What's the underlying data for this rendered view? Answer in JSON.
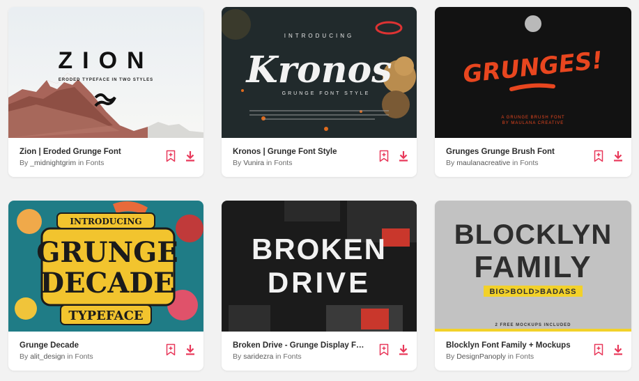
{
  "accent_color": "#e8385a",
  "cards": [
    {
      "title": "Zion | Eroded Grunge Font",
      "by": "By",
      "author": "_midnightgrim",
      "in_label": "in",
      "category": "Fonts",
      "thumb_text": "ZION",
      "thumb_sub": "ERODED TYPEFACE IN TWO STYLES"
    },
    {
      "title": "Kronos | Grunge Font Style",
      "by": "By",
      "author": "Vunira",
      "in_label": "in",
      "category": "Fonts",
      "thumb_text": "Kronos",
      "thumb_top": "INTRODUCING",
      "thumb_sub": "GRUNGE FONT STYLE"
    },
    {
      "title": "Grunges Grunge Brush Font",
      "by": "By",
      "author": "maulanacreative",
      "in_label": "in",
      "category": "Fonts",
      "thumb_text": "GRUNGES!",
      "thumb_sub": "A GRUNGE BRUSH FONT",
      "thumb_sub2": "BY MAULANA CREATIVE"
    },
    {
      "title": "Grunge Decade",
      "by": "By",
      "author": "alit_design",
      "in_label": "in",
      "category": "Fonts",
      "thumb_top": "INTRODUCING",
      "thumb_text": "GRUNGE",
      "thumb_text2": "DECADE",
      "thumb_sub": "TYPEFACE"
    },
    {
      "title": "Broken Drive - Grunge Display Font",
      "by": "By",
      "author": "saridezra",
      "in_label": "in",
      "category": "Fonts",
      "thumb_text": "BROKEN",
      "thumb_text2": "DRIVE"
    },
    {
      "title": "Blocklyn Font Family + Mockups",
      "by": "By",
      "author": "DesignPanoply",
      "in_label": "in",
      "category": "Fonts",
      "thumb_text": "BLOCKLYN",
      "thumb_text2": "FAMILY",
      "thumb_sub": "BIG>BOLD>BADASS",
      "thumb_sub2": "2 FREE MOCKUPS INCLUDED"
    }
  ],
  "icons": {
    "bookmark": "bookmark-add-icon",
    "download": "download-icon"
  }
}
